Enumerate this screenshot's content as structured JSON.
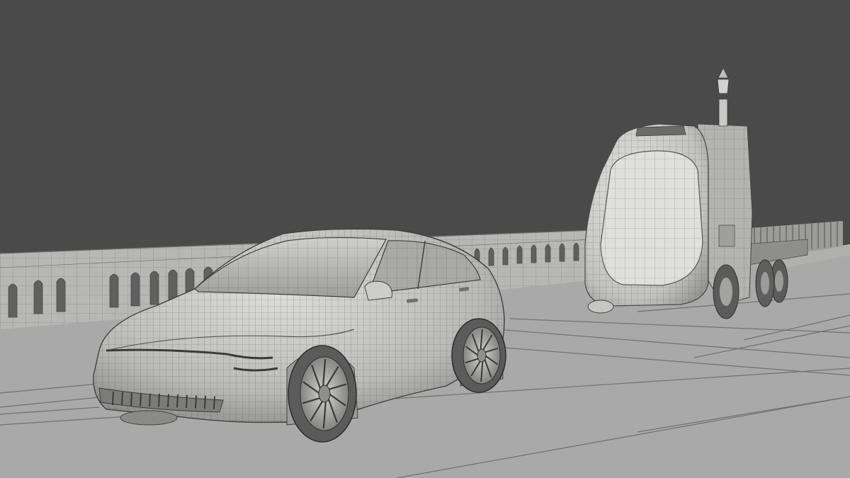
{
  "viewport": {
    "shading": "wireframe-on-shaded",
    "colors": {
      "background": "#4a4a4a",
      "ground": "#a8a9a8",
      "wall": "#b7b8b6",
      "body_light": "#d8d9d7",
      "body_mid": "#c3c4c2",
      "body_dark": "#8f908e",
      "tire": "#5a5b5a",
      "wire": "#3d3e3d"
    },
    "objects": [
      {
        "id": "suv",
        "label": ""
      },
      {
        "id": "autonomous-truck",
        "label": ""
      },
      {
        "id": "parapet-wall",
        "label": ""
      },
      {
        "id": "ground-plane",
        "label": ""
      }
    ]
  }
}
